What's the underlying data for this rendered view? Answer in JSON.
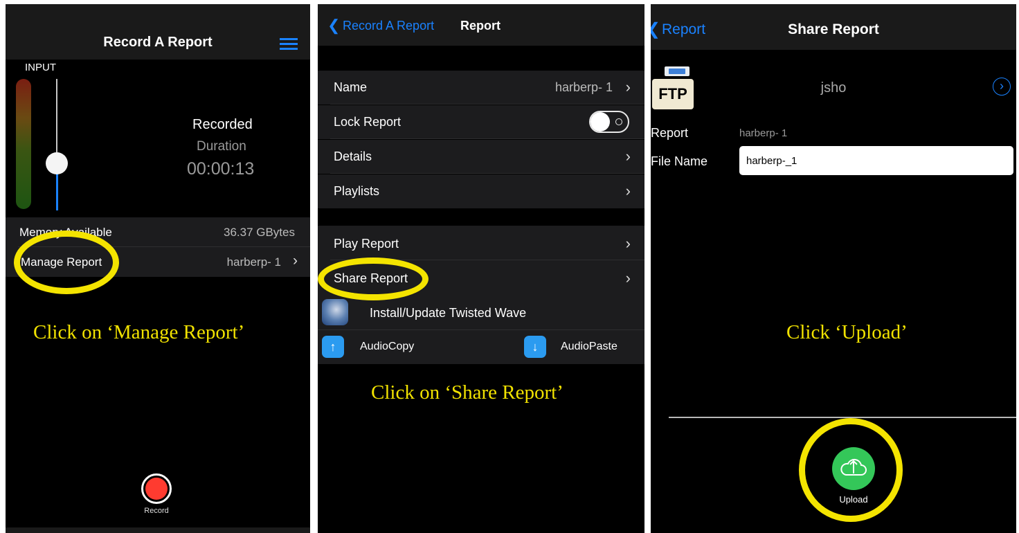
{
  "panel1": {
    "title": "Record A Report",
    "input_label": "INPUT",
    "recorded": "Recorded",
    "duration_label": "Duration",
    "duration_value": "00:00:13",
    "memory_label": "Memory Available",
    "memory_value": "36.37 GBytes",
    "manage_label": "Manage Report",
    "manage_value": "harberp- 1",
    "instruction": "Click on ‘Manage Report’",
    "record_label": "Record"
  },
  "panel2": {
    "back_label": "Record A Report",
    "title": "Report",
    "rows": {
      "name_label": "Name",
      "name_value": "harberp- 1",
      "lock_label": "Lock Report",
      "details_label": "Details",
      "playlists_label": "Playlists",
      "play_label": "Play Report",
      "share_label": "Share Report"
    },
    "install_label": "Install/Update Twisted Wave",
    "audiocopy_label": "AudioCopy",
    "audiopaste_label": "AudioPaste",
    "instruction": "Click on ‘Share Report’"
  },
  "panel3": {
    "back_label": "Report",
    "title": "Share Report",
    "ftp_label": "FTP",
    "account": "jsho",
    "report_label": "Report",
    "report_value": "harberp- 1",
    "filename_label": "File Name",
    "filename_value": "harberp-_1",
    "instruction": "Click ‘Upload’",
    "upload_label": "Upload"
  },
  "colors": {
    "accent_blue": "#1a82ff",
    "annotation_yellow": "#f1e200",
    "record_red": "#ff3b30",
    "upload_green": "#34c759"
  }
}
